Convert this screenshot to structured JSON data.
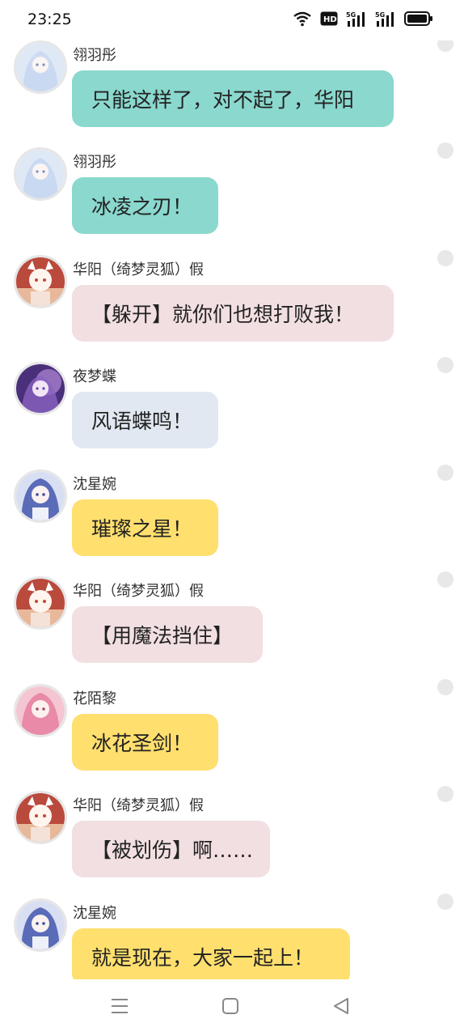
{
  "status": {
    "time": "23:25",
    "icons": [
      "wifi-icon",
      "hd-icon",
      "signal-5g-icon",
      "signal-5g-icon",
      "battery-icon"
    ]
  },
  "messages": [
    {
      "sender": "翎羽彤",
      "text": "只能这样了，对不起了，华阳",
      "avatar": "avatar-lingyutong",
      "color": "#8ad8ce"
    },
    {
      "sender": "翎羽彤",
      "text": "冰凌之刃！",
      "avatar": "avatar-lingyutong",
      "color": "#8ad8ce"
    },
    {
      "sender": "华阳（绮梦灵狐）假",
      "text": "【躲开】就你们也想打败我！",
      "avatar": "avatar-huayang",
      "color": "#f2dfe1"
    },
    {
      "sender": "夜梦蝶",
      "text": "风语蝶鸣！",
      "avatar": "avatar-yemengdie",
      "color": "#e1e8f1"
    },
    {
      "sender": "沈星婉",
      "text": "璀璨之星！",
      "avatar": "avatar-shenxingwan",
      "color": "#ffdf6e"
    },
    {
      "sender": "华阳（绮梦灵狐）假",
      "text": "【用魔法挡住】",
      "avatar": "avatar-huayang",
      "color": "#f2dfe1"
    },
    {
      "sender": "花陌黎",
      "text": "冰花圣剑！",
      "avatar": "avatar-huamoli",
      "color": "#ffdf6e"
    },
    {
      "sender": "华阳（绮梦灵狐）假",
      "text": "【被划伤】啊……",
      "avatar": "avatar-huayang",
      "color": "#f2dfe1"
    },
    {
      "sender": "沈星婉",
      "text": "就是现在，大家一起上！",
      "avatar": "avatar-shenxingwan",
      "color": "#ffdf6e"
    }
  ],
  "nav": {
    "icons": [
      "menu-icon",
      "home-icon",
      "back-icon"
    ]
  }
}
